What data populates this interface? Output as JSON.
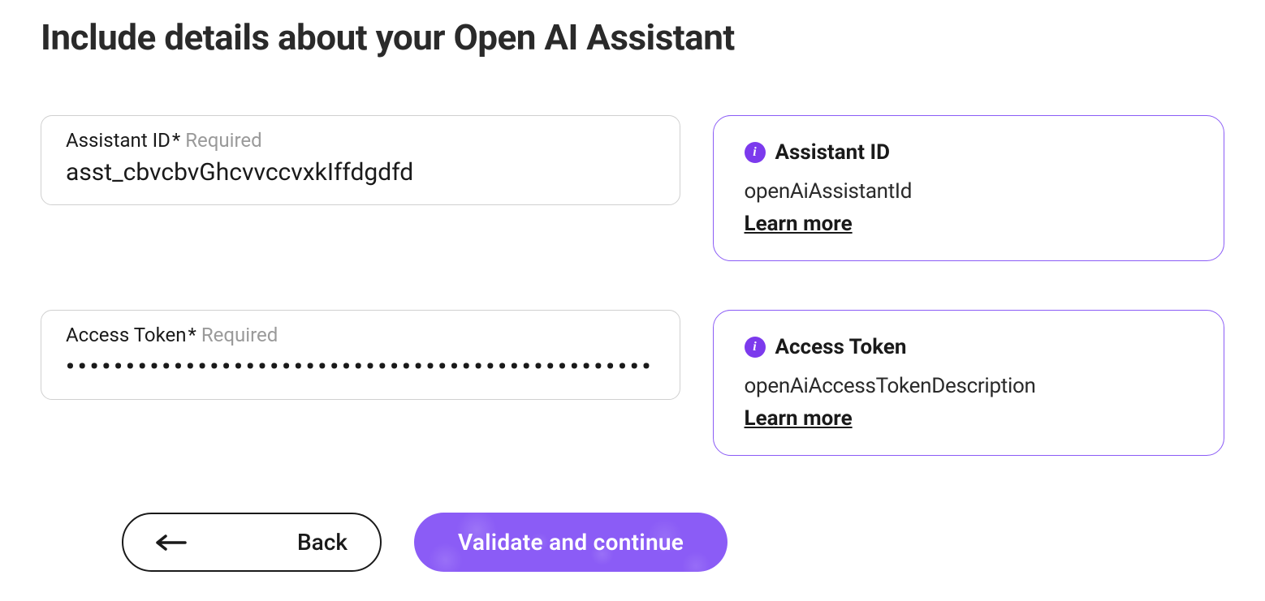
{
  "page": {
    "title": "Include details about your Open AI Assistant"
  },
  "fields": {
    "assistantId": {
      "label": "Assistant ID",
      "asterisk": "*",
      "required": "Required",
      "value": "asst_cbvcbvGhcvvccvxkIffdgdfd"
    },
    "accessToken": {
      "label": "Access Token",
      "asterisk": "*",
      "required": "Required",
      "value": "aaaaaaaaaaaaaaaaaaaaaaaaaaaaaaaaaaaaaaaaaaaaaaaaaaa"
    }
  },
  "info": {
    "assistantId": {
      "title": "Assistant ID",
      "description": "openAiAssistantId",
      "learnMore": "Learn more"
    },
    "accessToken": {
      "title": "Access Token",
      "description": "openAiAccessTokenDescription",
      "learnMore": "Learn more"
    }
  },
  "buttons": {
    "back": "Back",
    "validate": "Validate and continue"
  }
}
